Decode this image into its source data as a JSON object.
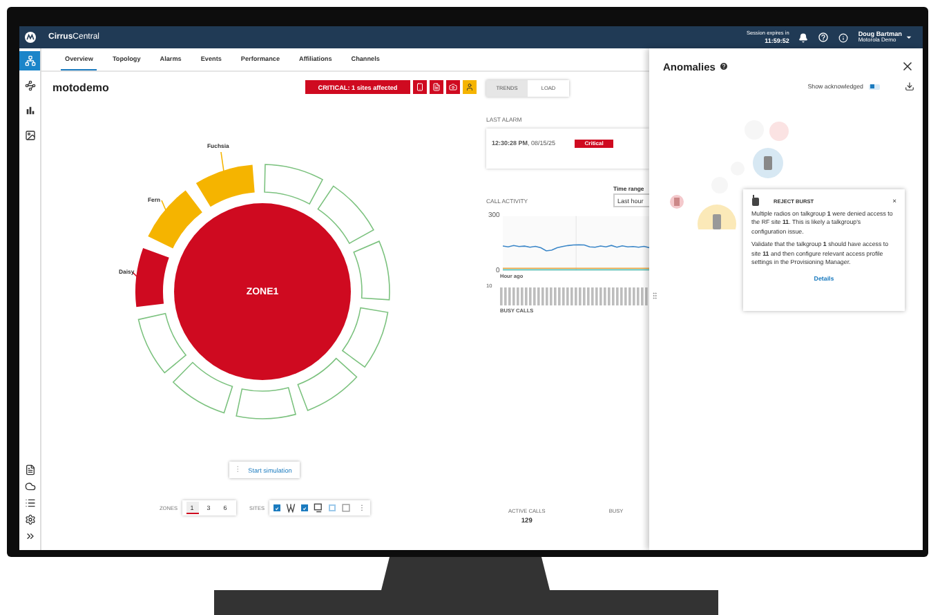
{
  "window": {
    "logo": "**Cirrus**Central",
    "session_label": "Session expires in",
    "session_time": "11:59:52",
    "user_name": "Doug Bartman",
    "user_org": "Motorola Demo"
  },
  "sidebar": {
    "top": [
      {
        "kind": "network",
        "selected": true
      },
      {
        "kind": "route",
        "selected": false
      },
      {
        "kind": "bars",
        "selected": false
      },
      {
        "kind": "image",
        "selected": false
      }
    ],
    "bottom": [
      {
        "kind": "report"
      },
      {
        "kind": "cloud"
      },
      {
        "kind": "list"
      },
      {
        "kind": "settings"
      },
      {
        "kind": "expand"
      }
    ]
  },
  "tabs": [
    {
      "label": "Overview",
      "selected": true
    },
    {
      "label": "Topology",
      "selected": false
    },
    {
      "label": "Alarms",
      "selected": false
    },
    {
      "label": "Events",
      "selected": false
    },
    {
      "label": "Performance",
      "selected": false
    },
    {
      "label": "Affiliations",
      "selected": false
    },
    {
      "label": "Channels",
      "selected": false
    }
  ],
  "page": {
    "title": "motodemo",
    "alert": {
      "color": "#cf0a20",
      "text": "CRITICAL: 1 sites affected"
    },
    "alert_actions": [
      {
        "kind": "radio",
        "color": "#cf0a20"
      },
      {
        "kind": "document",
        "color": "#cf0a20"
      },
      {
        "kind": "camera",
        "color": "#cf0a20"
      },
      {
        "kind": "person",
        "color": "#f5b400"
      }
    ]
  },
  "topology": {
    "zone": {
      "name": "ZONE1",
      "color": "#cf0a20"
    },
    "sites": [
      {
        "label": "Fuchsia",
        "color": "#f5b400"
      },
      {
        "label": "Fern",
        "color": "#f5b400"
      },
      {
        "label": "Daisy",
        "color": "#cf0a20"
      },
      {
        "color": "#7cc27f"
      },
      {
        "color": "#7cc27f"
      },
      {
        "color": "#7cc27f"
      },
      {
        "color": "#7cc27f"
      },
      {
        "color": "#7cc27f"
      },
      {
        "color": "#7cc27f"
      },
      {
        "color": "#7cc27f"
      },
      {
        "color": "#7cc27f"
      }
    ]
  },
  "simulation_button": {
    "menu": "⋮",
    "label": "Start simulation"
  },
  "zones": {
    "label": "ZONES",
    "options": [
      {
        "label": "1",
        "selected": true
      },
      {
        "label": "3",
        "selected": false
      },
      {
        "label": "6",
        "selected": false
      }
    ]
  },
  "sites_filter": {
    "label": "SITES",
    "options": [
      {
        "kind": "antenna",
        "checked": true
      },
      {
        "kind": "console",
        "checked": true
      },
      {
        "kind": "radio",
        "checked": false
      }
    ],
    "more": "⋮"
  },
  "trends": {
    "views": [
      {
        "label": "TRENDS",
        "selected": true
      },
      {
        "label": "LOAD",
        "selected": false
      }
    ],
    "last_alarm": {
      "heading": "LAST ALARM",
      "time": "**12:30:28 PM**, 08/15/25",
      "badge": "Critical",
      "color": "#cf0a20"
    },
    "time_range": {
      "label": "Time range",
      "value": "Last hour"
    },
    "call_activity": {
      "heading": "CALL ACTIVITY",
      "start_label": "Hour ago",
      "chart_data": {
        "type": "line",
        "ylim": [
          0,
          300
        ],
        "yticks": [
          {
            "value": 0,
            "label": "0"
          },
          {
            "value": 300,
            "label": "300"
          }
        ],
        "series": [
          {
            "color": "#3a86c8",
            "values": [
              135,
              130,
              137,
              132,
              134,
              128,
              133,
              125,
              108,
              112,
              125,
              132,
              137,
              140,
              142,
              140,
              130,
              128,
              135,
              130,
              138,
              128,
              136,
              130,
              132,
              128,
              133,
              125
            ]
          },
          {
            "color": "#e8a33c",
            "values": [
              12,
              12,
              12,
              12,
              12,
              12,
              12,
              12,
              12,
              12,
              12,
              12,
              12,
              12,
              12,
              12,
              12,
              12,
              12,
              12,
              12,
              12,
              12,
              12,
              12,
              12,
              12,
              12
            ]
          },
          {
            "color": "#3fb5a8",
            "values": [
              0,
              0,
              0,
              0,
              0,
              0,
              0,
              0,
              0,
              0,
              0,
              0,
              0,
              0,
              0,
              0,
              0,
              0,
              0,
              0,
              0,
              0,
              0,
              0,
              0,
              0,
              0,
              0
            ]
          }
        ]
      },
      "busy_tick": "10",
      "busy_label": "BUSY CALLS"
    },
    "stats": [
      {
        "label": "ACTIVE CALLS",
        "value": "129"
      },
      {
        "label": "BUSY"
      }
    ]
  },
  "anomalies": {
    "title": "Anomalies",
    "show_acknowledged": {
      "label": "Show acknowledged",
      "on": true
    },
    "popup": {
      "title": "REJECT BURST",
      "close": "×",
      "paragraphs": [
        "Multiple radios on talkgroup **1** were denied access to the RF site **11**. This is likely a talkgroup's configuration issue.",
        "Validate that the talkgroup **1** should have access to site **11** and then configure relevant access profile settings in the Provisioning Manager."
      ],
      "link": "Details"
    }
  }
}
